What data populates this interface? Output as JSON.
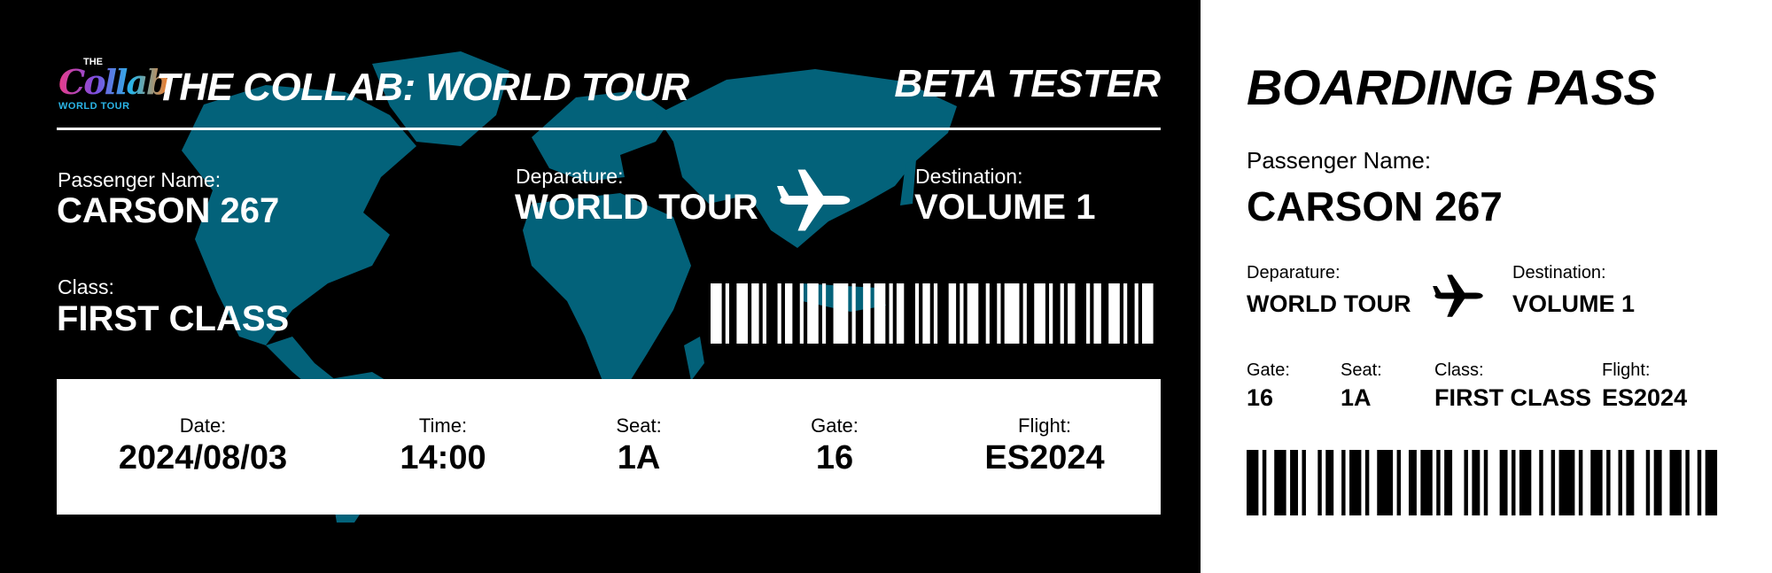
{
  "colors": {
    "map": "#03627a",
    "background": "#000000",
    "stub": "#ffffff"
  },
  "header": {
    "logo": {
      "top": "THE",
      "word": "Collab",
      "sub": "WORLD TOUR"
    },
    "title": "THE COLLAB: WORLD TOUR",
    "badge": "BETA TESTER"
  },
  "main": {
    "passenger": {
      "label": "Passenger Name:",
      "value": "CARSON 267"
    },
    "departure": {
      "label": "Deparature:",
      "value": "WORLD TOUR"
    },
    "destination": {
      "label": "Destination:",
      "value": "VOLUME 1"
    },
    "class": {
      "label": "Class:",
      "value": "FIRST CLASS"
    },
    "plane_icon": "airplane-icon",
    "strip": [
      {
        "label": "Date:",
        "value": "2024/08/03"
      },
      {
        "label": "Time:",
        "value": "14:00"
      },
      {
        "label": "Seat:",
        "value": "1A"
      },
      {
        "label": "Gate:",
        "value": "16"
      },
      {
        "label": "Flight:",
        "value": "ES2024"
      }
    ]
  },
  "stub": {
    "title": "BOARDING PASS",
    "passenger": {
      "label": "Passenger Name:",
      "value": "CARSON 267"
    },
    "departure": {
      "label": "Deparature:",
      "value": "WORLD TOUR"
    },
    "destination": {
      "label": "Destination:",
      "value": "VOLUME 1"
    },
    "plane_icon": "airplane-icon",
    "gate": {
      "label": "Gate:",
      "value": "16"
    },
    "seat": {
      "label": "Seat:",
      "value": "1A"
    },
    "class": {
      "label": "Class:",
      "value": "FIRST CLASS"
    },
    "flight": {
      "label": "Flight:",
      "value": "ES2024"
    }
  }
}
